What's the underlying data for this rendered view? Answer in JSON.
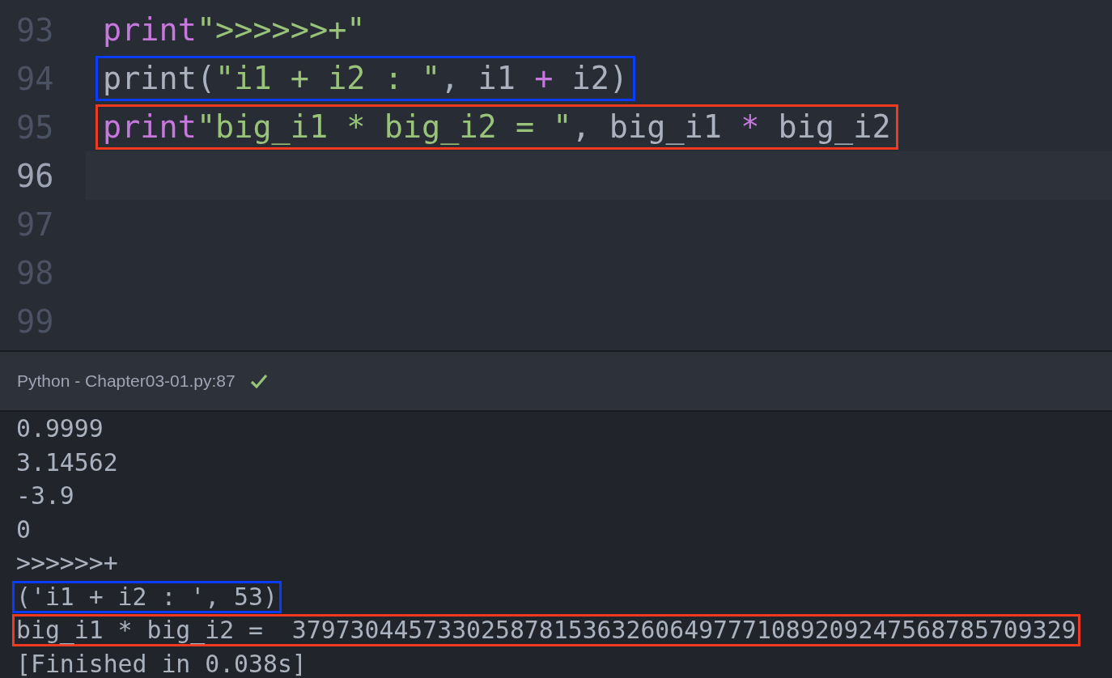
{
  "editor": {
    "lines": [
      {
        "number": "93",
        "current": false,
        "tokens": [
          {
            "kind": "keyword",
            "text": "print"
          },
          {
            "kind": "string",
            "text": "\">>>>>>+\""
          }
        ]
      },
      {
        "number": "94",
        "current": false,
        "color": "#0a3cff",
        "tokens": [
          {
            "kind": "plain",
            "text": "print("
          },
          {
            "kind": "string",
            "text": "\"i1 + i2 : \""
          },
          {
            "kind": "plain",
            "text": ", i1 "
          },
          {
            "kind": "keyword",
            "text": "+"
          },
          {
            "kind": "plain",
            "text": " i2)"
          }
        ]
      },
      {
        "number": "95",
        "current": false,
        "color": "#f0391f",
        "tokens": [
          {
            "kind": "keyword",
            "text": "print"
          },
          {
            "kind": "string",
            "text": "\"big_i1 * big_i2 = \""
          },
          {
            "kind": "plain",
            "text": ", big_i1 "
          },
          {
            "kind": "keyword",
            "text": "*"
          },
          {
            "kind": "plain",
            "text": " big_i2"
          }
        ]
      },
      {
        "number": "96",
        "current": true
      },
      {
        "number": "97",
        "current": false
      },
      {
        "number": "98",
        "current": false
      },
      {
        "number": "99",
        "current": false
      }
    ]
  },
  "status_bar": {
    "label": "Python - Chapter03-01.py:87",
    "success": true
  },
  "output": {
    "lines": [
      {
        "text": "0.9999"
      },
      {
        "text": "3.14562"
      },
      {
        "text": "-3.9"
      },
      {
        "text": "0"
      },
      {
        "text": ">>>>>>+"
      },
      {
        "text": "('i1 + i2 : ', 53)",
        "color": "#0a3cff"
      },
      {
        "text": "big_i1 * big_i2 =  379730445733025878153632606497771089209247568785709329",
        "color": "#f0391f"
      },
      {
        "text": "[Finished in 0.038s]"
      }
    ]
  }
}
